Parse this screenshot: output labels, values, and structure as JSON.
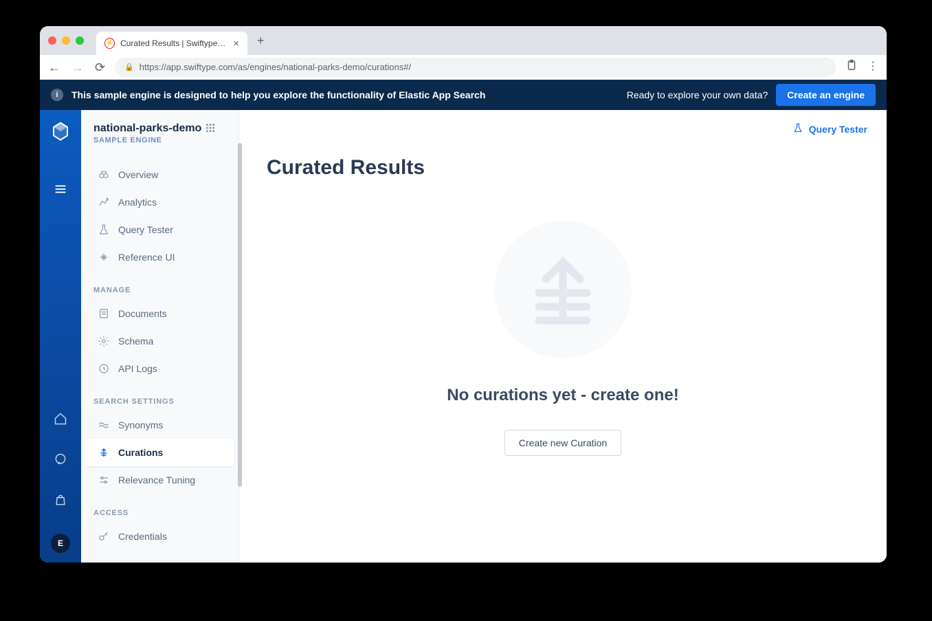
{
  "browser": {
    "tab_title": "Curated Results | Swiftype App",
    "url": "https://app.swiftype.com/as/engines/national-parks-demo/curations#/"
  },
  "banner": {
    "text": "This sample engine is designed to help you explore the functionality of Elastic App Search",
    "right_text": "Ready to explore your own data?",
    "button": "Create an engine"
  },
  "engine": {
    "name": "national-parks-demo",
    "label": "SAMPLE ENGINE"
  },
  "sidebar": {
    "items": [
      {
        "label": "Overview"
      },
      {
        "label": "Analytics"
      },
      {
        "label": "Query Tester"
      },
      {
        "label": "Reference UI"
      }
    ],
    "manage_title": "MANAGE",
    "manage": [
      {
        "label": "Documents"
      },
      {
        "label": "Schema"
      },
      {
        "label": "API Logs"
      }
    ],
    "search_title": "SEARCH SETTINGS",
    "search": [
      {
        "label": "Synonyms"
      },
      {
        "label": "Curations"
      },
      {
        "label": "Relevance Tuning"
      }
    ],
    "access_title": "ACCESS",
    "access": [
      {
        "label": "Credentials"
      }
    ]
  },
  "main": {
    "query_tester": "Query Tester",
    "title": "Curated Results",
    "empty_title": "No curations yet - create one!",
    "create_button": "Create new Curation"
  },
  "avatar_letter": "E"
}
